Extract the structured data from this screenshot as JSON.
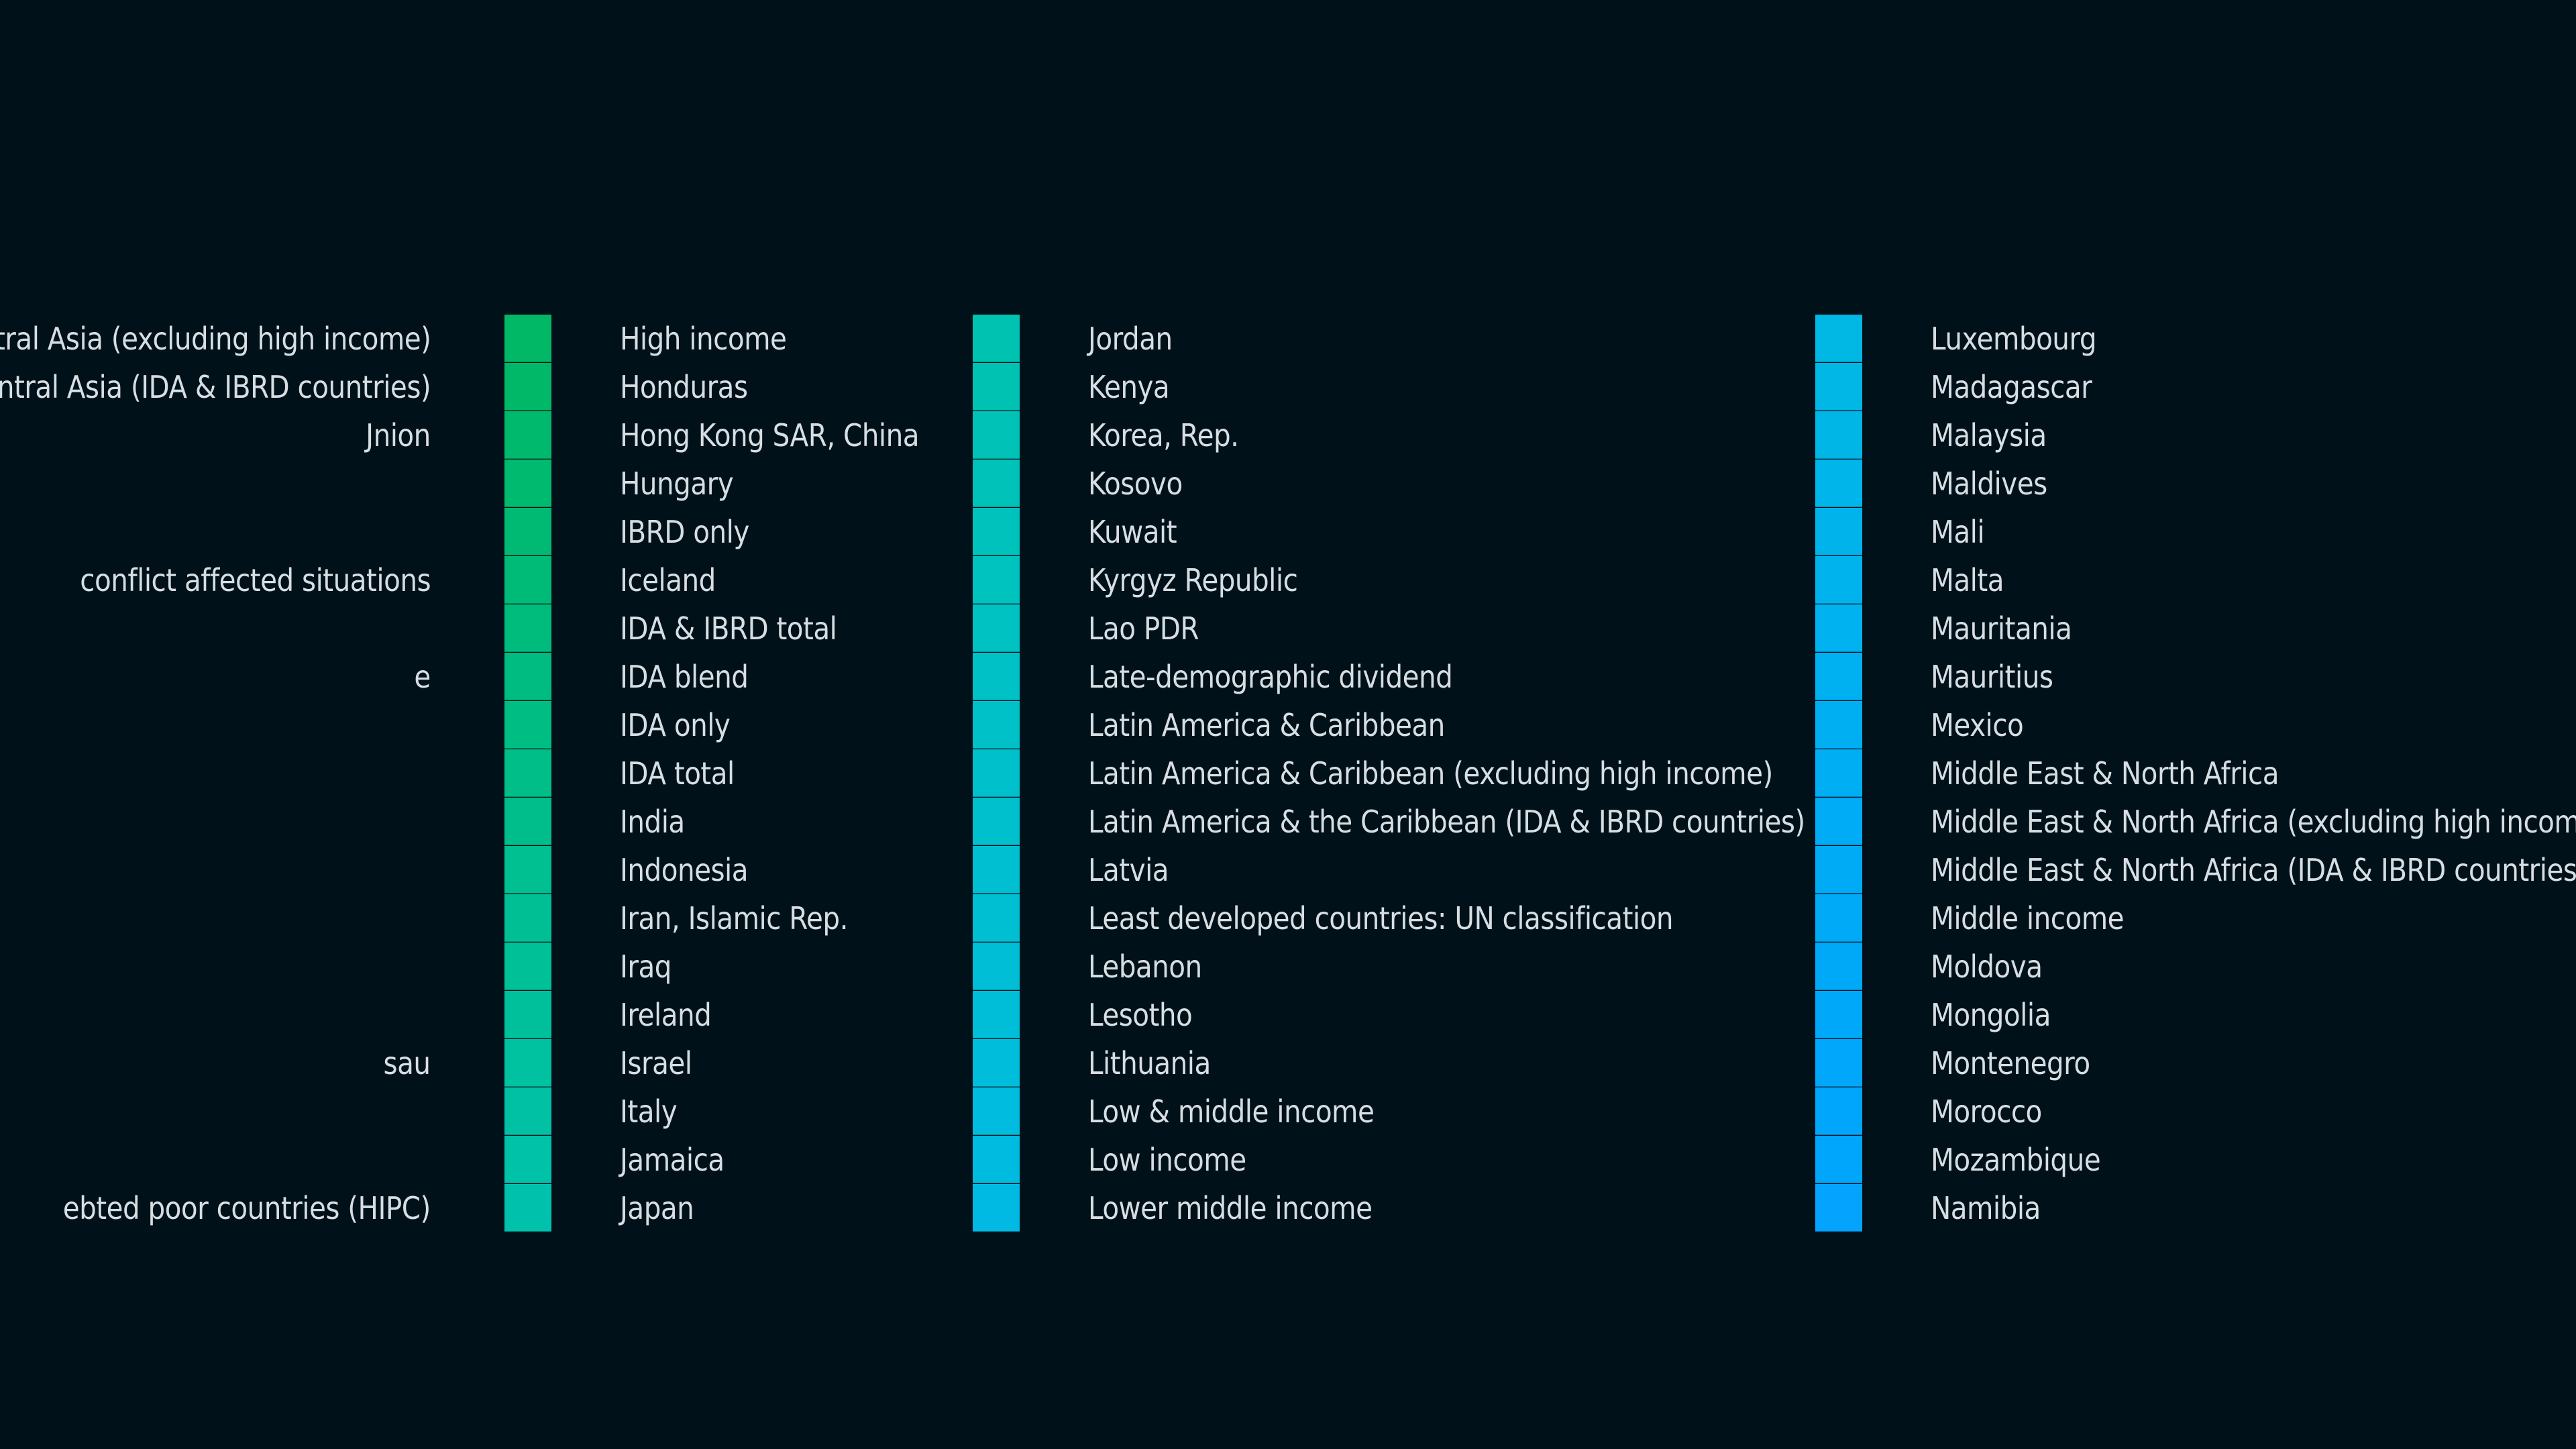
{
  "chart_data": {
    "type": "legend",
    "columns": [
      {
        "key": "col0",
        "labels": [
          "entral Asia (excluding high income)",
          "entral Asia (IDA & IBRD countries)",
          "Jnion",
          "",
          "",
          "conflict affected situations",
          "",
          "e",
          "",
          "",
          "",
          "",
          "",
          "",
          "",
          "sau",
          "",
          "",
          "ebted poor countries (HIPC)"
        ],
        "colors": []
      },
      {
        "key": "col1",
        "labels": [
          "High income",
          "Honduras",
          "Hong Kong SAR, China",
          "Hungary",
          "IBRD only",
          "Iceland",
          "IDA & IBRD total",
          "IDA blend",
          "IDA only",
          "IDA total",
          "India",
          "Indonesia",
          "Iran, Islamic Rep.",
          "Iraq",
          "Ireland",
          "Israel",
          "Italy",
          "Jamaica",
          "Japan"
        ],
        "colors": [
          "#00b865",
          "#00b868",
          "#00b96c",
          "#00ba70",
          "#00ba74",
          "#00bb78",
          "#00bc7c",
          "#00bc80",
          "#00bd84",
          "#00be88",
          "#00be8c",
          "#00bf90",
          "#00bf94",
          "#00c098",
          "#00c09c",
          "#00c1a0",
          "#00c1a4",
          "#00c2a8",
          "#00c2ac"
        ]
      },
      {
        "key": "col2",
        "labels": [
          "Jordan",
          "Kenya",
          "Korea, Rep.",
          "Kosovo",
          "Kuwait",
          "Kyrgyz Republic",
          "Lao PDR",
          "Late-demographic dividend",
          "Latin America & Caribbean",
          "Latin America & Caribbean (excluding high income)",
          "Latin America & the Caribbean (IDA & IBRD countries)",
          "Latvia",
          "Least developed countries: UN classification",
          "Lebanon",
          "Lesotho",
          "Lithuania",
          "Low & middle income",
          "Low income",
          "Lower middle income"
        ],
        "colors": [
          "#00c2b0",
          "#00c2b3",
          "#00c2b6",
          "#00c2b9",
          "#00c2bc",
          "#00c2bf",
          "#00c2c2",
          "#00c1c5",
          "#00c1c8",
          "#00c0cb",
          "#00c0ce",
          "#00bfd0",
          "#00bfd3",
          "#00bed6",
          "#00bed8",
          "#00bddb",
          "#00bcde",
          "#00bbe0",
          "#00bae3"
        ]
      },
      {
        "key": "col3",
        "labels": [
          "Luxembourg",
          "Madagascar",
          "Malaysia",
          "Maldives",
          "Mali",
          "Malta",
          "Mauritania",
          "Mauritius",
          "Mexico",
          "Middle East & North Africa",
          "Middle East & North Africa (excluding high income)",
          "Middle East & North Africa (IDA & IBRD countries)",
          "Middle income",
          "Moldova",
          "Mongolia",
          "Montenegro",
          "Morocco",
          "Mozambique",
          "Namibia"
        ],
        "colors": [
          "#00b8e3",
          "#00b7e5",
          "#00b6e7",
          "#00b5e9",
          "#00b4eb",
          "#00b3ed",
          "#00b2ef",
          "#00b1f1",
          "#00aff2",
          "#00aef4",
          "#00acf5",
          "#00abf6",
          "#00aaf7",
          "#00a9f8",
          "#00a8f9",
          "#00a7fa",
          "#00a6fb",
          "#00a5fc",
          "#04a3fd"
        ]
      }
    ]
  }
}
